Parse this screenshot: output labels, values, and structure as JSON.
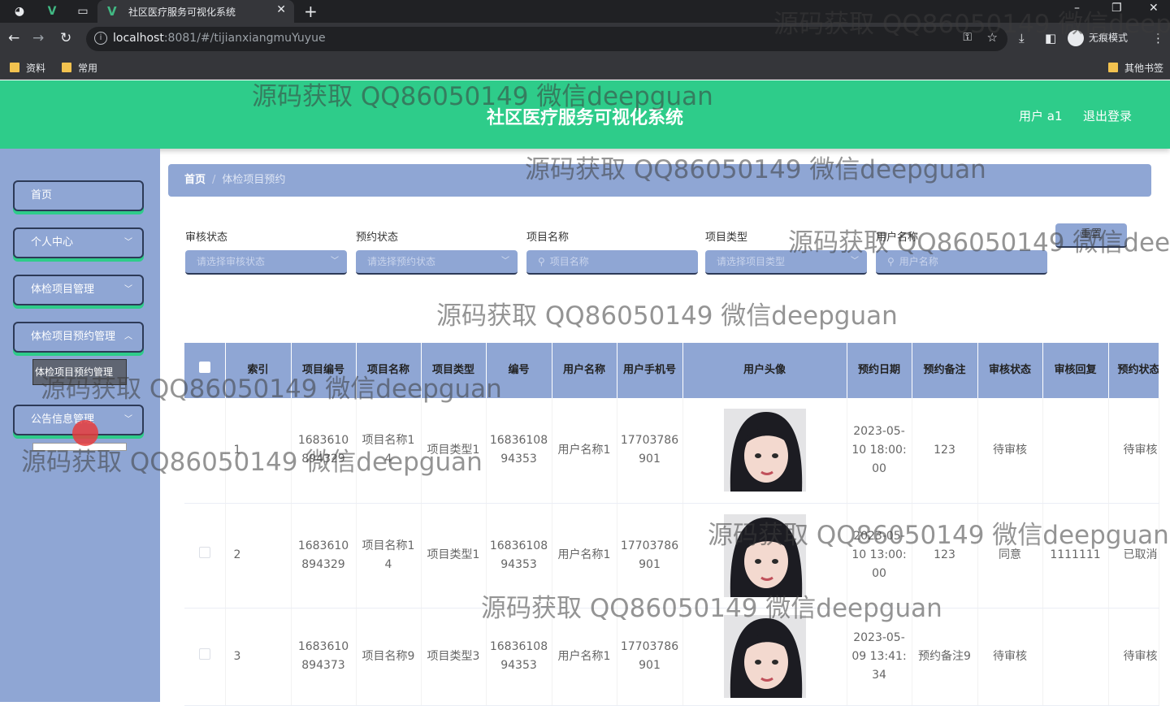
{
  "browser": {
    "tab_title": "社区医疗服务可视化系统",
    "url_host": "localhost",
    "url_rest": ":8081/#/tijianxiangmuYuyue",
    "incognito_label": "无痕模式",
    "bookmarks": [
      "资料",
      "常用"
    ],
    "other_bookmarks": "其他书签"
  },
  "header": {
    "title": "社区医疗服务可视化系统",
    "user": "用户 a1",
    "logout": "退出登录"
  },
  "sidebar": {
    "items": [
      {
        "label": "首页",
        "has_arrow": false
      },
      {
        "label": "个人中心",
        "has_arrow": true
      },
      {
        "label": "体检项目管理",
        "has_arrow": true
      },
      {
        "label": "体检项目预约管理",
        "has_arrow": true
      },
      {
        "label": "公告信息管理",
        "has_arrow": true
      }
    ],
    "submenu_popup": "体检项目预约管理"
  },
  "breadcrumb": {
    "home": "首页",
    "separator": "/",
    "current": "体检项目预约"
  },
  "filters": {
    "audit_status": {
      "label": "审核状态",
      "placeholder": "请选择审核状态"
    },
    "booking_status": {
      "label": "预约状态",
      "placeholder": "请选择预约状态"
    },
    "item_name": {
      "label": "项目名称",
      "placeholder": "项目名称"
    },
    "item_type": {
      "label": "项目类型",
      "placeholder": "请选择项目类型"
    },
    "user_name": {
      "label": "用户名称",
      "placeholder": "用户名称"
    },
    "reset": "重置"
  },
  "table": {
    "columns": [
      "",
      "索引",
      "项目编号",
      "项目名称",
      "项目类型",
      "编号",
      "用户名称",
      "用户手机号",
      "用户头像",
      "预约日期",
      "预约备注",
      "审核状态",
      "审核回复",
      "预约状态"
    ],
    "rows": [
      {
        "index": "1",
        "item_no": "1683610894329",
        "item_name": "项目名称14",
        "item_type": "项目类型1",
        "no": "1683610894353",
        "user_name": "用户名称1",
        "phone": "17703786901",
        "date": "2023-05-10 18:00:00",
        "note": "123",
        "audit": "待审核",
        "reply": "",
        "status": "待审核"
      },
      {
        "index": "2",
        "item_no": "1683610894329",
        "item_name": "项目名称14",
        "item_type": "项目类型1",
        "no": "1683610894353",
        "user_name": "用户名称1",
        "phone": "17703786901",
        "date": "2023-05-10 13:00:00",
        "note": "123",
        "audit": "同意",
        "reply": "1111111",
        "status": "已取消"
      },
      {
        "index": "3",
        "item_no": "1683610894373",
        "item_name": "项目名称9",
        "item_type": "项目类型3",
        "no": "1683610894353",
        "user_name": "用户名称1",
        "phone": "17703786901",
        "date": "2023-05-09 13:41:34",
        "note": "预约备注9",
        "audit": "待审核",
        "reply": "",
        "status": "待审核"
      }
    ]
  },
  "watermark": "源码获取 QQ86050149 微信deepguan",
  "colors": {
    "header_green": "#2ecc8a",
    "panel_blue": "#8fa6d4",
    "border_dark": "#2d3a57"
  }
}
